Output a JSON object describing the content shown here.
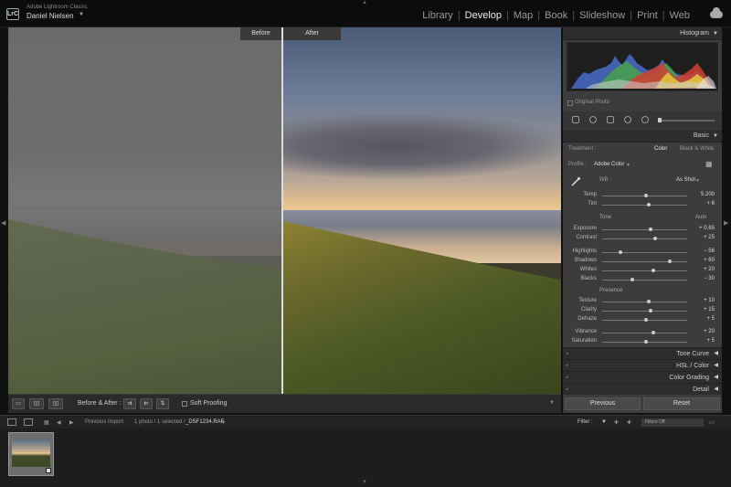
{
  "app": {
    "subtitle": "Adobe Lightroom Classic",
    "logo_text": "LrC",
    "user": "Daniel Nielsen"
  },
  "modules": [
    "Library",
    "Develop",
    "Map",
    "Book",
    "Slideshow",
    "Print",
    "Web"
  ],
  "active_module": "Develop",
  "viewer": {
    "before_label": "Before",
    "after_label": "After"
  },
  "toolbar": {
    "before_after_label": "Before & After :",
    "soft_proofing_label": "Soft Proofing"
  },
  "panel": {
    "histogram_title": "Histogram",
    "original_photo_label": "Original Photo",
    "basic_title": "Basic",
    "treatment_label": "Treatment :",
    "treatment_color": "Color",
    "treatment_bw": "Black & White",
    "profile_label": "Profile :",
    "profile_value": "Adobe Color",
    "wb_label": "WB :",
    "wb_value": "As Shot",
    "tone_label": "Tone",
    "auto_label": "Auto",
    "presence_label": "Presence",
    "wb_sliders": [
      {
        "label": "Temp",
        "value": "5.200",
        "pos": 0.52
      },
      {
        "label": "Tint",
        "value": "+ 6",
        "pos": 0.55
      }
    ],
    "tone_sliders": [
      {
        "label": "Exposure",
        "value": "+ 0,65",
        "pos": 0.57
      },
      {
        "label": "Contrast",
        "value": "+ 25",
        "pos": 0.62
      }
    ],
    "tone_sliders2": [
      {
        "label": "Highlights",
        "value": "− 56",
        "pos": 0.22
      },
      {
        "label": "Shadows",
        "value": "+ 60",
        "pos": 0.8
      },
      {
        "label": "Whites",
        "value": "+ 20",
        "pos": 0.6
      },
      {
        "label": "Blacks",
        "value": "− 30",
        "pos": 0.35
      }
    ],
    "presence_sliders": [
      {
        "label": "Texture",
        "value": "+ 10",
        "pos": 0.55
      },
      {
        "label": "Clarity",
        "value": "+ 15",
        "pos": 0.57
      },
      {
        "label": "Dehaze",
        "value": "+ 5",
        "pos": 0.52
      }
    ],
    "color_sliders": [
      {
        "label": "Vibrance",
        "value": "+ 20",
        "pos": 0.6
      },
      {
        "label": "Saturation",
        "value": "+ 5",
        "pos": 0.52
      }
    ],
    "tone_curve_title": "Tone Curve",
    "hsl_title": "HSL / Color",
    "color_grading_title": "Color Grading",
    "detail_title": "Detail",
    "previous_button": "Previous",
    "reset_button": "Reset"
  },
  "filmbar": {
    "previous_import": "Previous Import",
    "selection_info": "1 photo / 1 selected /",
    "filename": "_DSF1234.RAF",
    "filter_label": "Filter :",
    "filter_value": "Filters Off"
  },
  "colors": {
    "accent": "#dddddd",
    "panel_bg": "#3c3c3c",
    "header_bg": "#2d2d2d"
  }
}
